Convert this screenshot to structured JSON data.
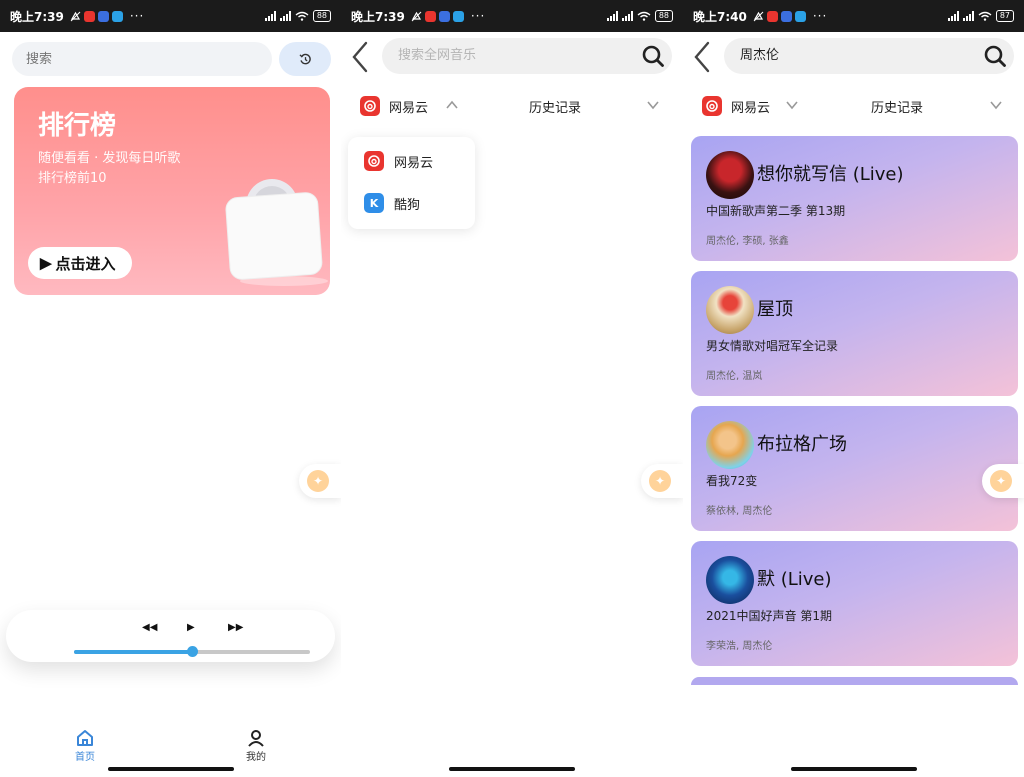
{
  "panels": [
    {
      "status": {
        "time": "晚上7:39",
        "battery": "88"
      },
      "search": {
        "placeholder": "搜索"
      },
      "ranking": {
        "title": "排行榜",
        "subtitle": "随便看看 · 发现每日听歌",
        "subtitle2": "排行榜前10",
        "enter_label": "点击进入"
      },
      "player": {
        "progress": 0.5
      },
      "tabs": [
        {
          "label": "首页",
          "active": true
        },
        {
          "label": "我的",
          "active": false
        }
      ]
    },
    {
      "status": {
        "time": "晚上7:39",
        "battery": "88"
      },
      "search": {
        "placeholder": "搜索全网音乐"
      },
      "source": {
        "label": "网易云",
        "history_label": "历史记录"
      },
      "dropdown": [
        {
          "label": "网易云"
        },
        {
          "label": "酷狗"
        }
      ]
    },
    {
      "status": {
        "time": "晚上7:40",
        "battery": "87"
      },
      "search": {
        "value": "周杰伦"
      },
      "source": {
        "label": "网易云",
        "history_label": "历史记录"
      },
      "songs": [
        {
          "title": "想你就写信 (Live)",
          "album": "中国新歌声第二季 第13期",
          "artists": "周杰伦, 李硕, 张鑫"
        },
        {
          "title": "屋顶",
          "album": "男女情歌对唱冠军全记录",
          "artists": "周杰伦, 温岚"
        },
        {
          "title": "布拉格广场",
          "album": "看我72变",
          "artists": "蔡依林, 周杰伦"
        },
        {
          "title": "默 (Live)",
          "album": "2021中国好声音 第1期",
          "artists": "李荣浩, 周杰伦"
        }
      ]
    }
  ],
  "colors": {
    "accent": "#3aa3e4",
    "netease_red": "#e9352f",
    "kugou_blue": "#2f8ee8",
    "ranking_card": "#ff9a9a",
    "song_card_start": "#a8a4f2",
    "song_card_end": "#f4c2d8"
  },
  "icons": {
    "history": "history-icon",
    "back": "back-chevron-icon",
    "search": "search-icon",
    "home": "home-icon",
    "profile": "user-icon",
    "accessibility": "accessibility-icon"
  }
}
